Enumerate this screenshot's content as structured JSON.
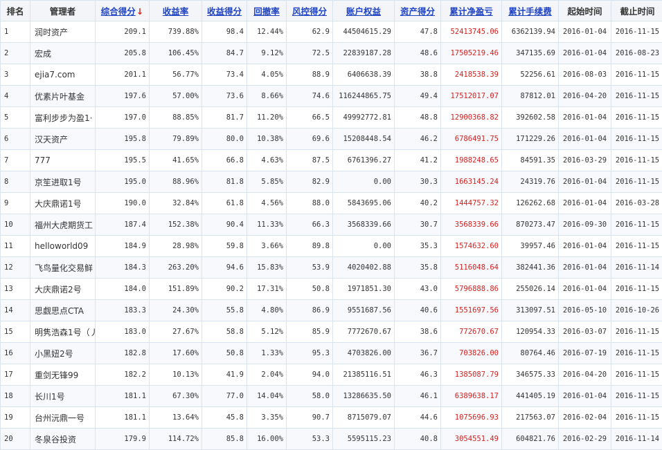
{
  "table": {
    "headers": [
      "排名",
      "管理者",
      "综合得分",
      "收益率",
      "收益得分",
      "回撤率",
      "风控得分",
      "账户权益",
      "资产得分",
      "累计净盈亏",
      "累计手续费",
      "起始时间",
      "截止时间"
    ],
    "sort_arrow": "↓",
    "rows": [
      [
        "1",
        "润时资产",
        "209.1",
        "739.88%",
        "98.4",
        "12.44%",
        "62.9",
        "44504615.29",
        "47.8",
        "52413745.06",
        "6362139.94",
        "2016-01-04",
        "2016-11-15"
      ],
      [
        "2",
        "宏成",
        "205.8",
        "106.45%",
        "84.7",
        "9.12%",
        "72.5",
        "22839187.28",
        "48.6",
        "17505219.46",
        "347135.69",
        "2016-01-04",
        "2016-08-23"
      ],
      [
        "3",
        "ejia7.com",
        "201.1",
        "56.77%",
        "73.4",
        "4.05%",
        "88.9",
        "6406638.39",
        "38.8",
        "2418538.39",
        "52256.61",
        "2016-08-03",
        "2016-11-15"
      ],
      [
        "4",
        "优素片叶基金",
        "197.6",
        "57.00%",
        "73.6",
        "8.66%",
        "74.6",
        "116244865.75",
        "49.4",
        "17512017.07",
        "87812.01",
        "2016-04-20",
        "2016-11-15"
      ],
      [
        "5",
        "富利步步为盈1·",
        "197.0",
        "88.85%",
        "81.7",
        "11.20%",
        "66.5",
        "49992772.81",
        "48.8",
        "12900368.82",
        "392602.58",
        "2016-01-04",
        "2016-11-15"
      ],
      [
        "6",
        "汉天资产",
        "195.8",
        "79.89%",
        "80.0",
        "10.38%",
        "69.6",
        "15208448.54",
        "46.2",
        "6786491.75",
        "171229.26",
        "2016-01-04",
        "2016-11-15"
      ],
      [
        "7",
        "777",
        "195.5",
        "41.65%",
        "66.8",
        "4.63%",
        "87.5",
        "6761396.27",
        "41.2",
        "1988248.65",
        "84591.35",
        "2016-03-29",
        "2016-11-15"
      ],
      [
        "8",
        "京笙进取1号",
        "195.0",
        "88.96%",
        "81.8",
        "5.85%",
        "82.9",
        "0.00",
        "30.3",
        "1663145.24",
        "24319.76",
        "2016-01-04",
        "2016-11-15"
      ],
      [
        "9",
        "大庆鼎诺1号",
        "190.0",
        "32.84%",
        "61.8",
        "4.56%",
        "88.0",
        "5843695.06",
        "40.2",
        "1444757.32",
        "126262.68",
        "2016-01-04",
        "2016-03-28"
      ],
      [
        "10",
        "福州大虎期货工",
        "187.4",
        "152.38%",
        "90.4",
        "11.33%",
        "66.3",
        "3568339.66",
        "30.7",
        "3568339.66",
        "870273.47",
        "2016-09-30",
        "2016-11-15"
      ],
      [
        "11",
        "helloworld09",
        "184.9",
        "28.98%",
        "59.8",
        "3.66%",
        "89.8",
        "0.00",
        "35.3",
        "1574632.60",
        "39957.46",
        "2016-01-04",
        "2016-11-15"
      ],
      [
        "12",
        "飞鸟量化交易鲜",
        "184.3",
        "263.20%",
        "94.6",
        "15.83%",
        "53.9",
        "4020402.88",
        "35.8",
        "5116048.64",
        "382441.36",
        "2016-01-04",
        "2016-11-14"
      ],
      [
        "13",
        "大庆鼎诺2号",
        "184.0",
        "151.89%",
        "90.2",
        "17.31%",
        "50.8",
        "1971851.30",
        "43.0",
        "5796888.86",
        "255026.14",
        "2016-01-04",
        "2016-11-15"
      ],
      [
        "14",
        "思觑思点CTA",
        "183.3",
        "24.30%",
        "55.8",
        "4.80%",
        "86.9",
        "9551687.56",
        "40.6",
        "1551697.56",
        "313097.51",
        "2016-05-10",
        "2016-10-26"
      ],
      [
        "15",
        "明隽浩森1号（丿",
        "183.0",
        "27.67%",
        "58.8",
        "5.12%",
        "85.9",
        "7772670.67",
        "38.6",
        "772670.67",
        "120954.33",
        "2016-03-07",
        "2016-11-15"
      ],
      [
        "16",
        "小黑妞2号",
        "182.8",
        "17.60%",
        "50.8",
        "1.33%",
        "95.3",
        "4703826.00",
        "36.7",
        "703826.00",
        "80764.46",
        "2016-07-19",
        "2016-11-15"
      ],
      [
        "17",
        "重剑无锋99",
        "182.2",
        "10.13%",
        "41.9",
        "2.04%",
        "94.0",
        "21385116.51",
        "46.3",
        "1385087.79",
        "346575.33",
        "2016-04-20",
        "2016-11-15"
      ],
      [
        "18",
        "长川1号",
        "181.1",
        "67.30%",
        "77.0",
        "14.04%",
        "58.0",
        "13286635.50",
        "46.1",
        "6389638.17",
        "441405.19",
        "2016-01-04",
        "2016-11-15"
      ],
      [
        "19",
        "台州沅鼎一号",
        "181.1",
        "13.64%",
        "45.8",
        "3.35%",
        "90.7",
        "8715079.07",
        "44.6",
        "1075696.93",
        "217563.07",
        "2016-02-04",
        "2016-11-15"
      ],
      [
        "20",
        "冬泉谷投资",
        "179.9",
        "114.72%",
        "85.8",
        "16.00%",
        "53.3",
        "5595115.23",
        "40.8",
        "3054551.49",
        "604821.76",
        "2016-02-29",
        "2016-11-14"
      ]
    ]
  },
  "colors": {
    "link": "#1f43c4",
    "red": "#d21f1f",
    "border": "#d9e3ee"
  }
}
